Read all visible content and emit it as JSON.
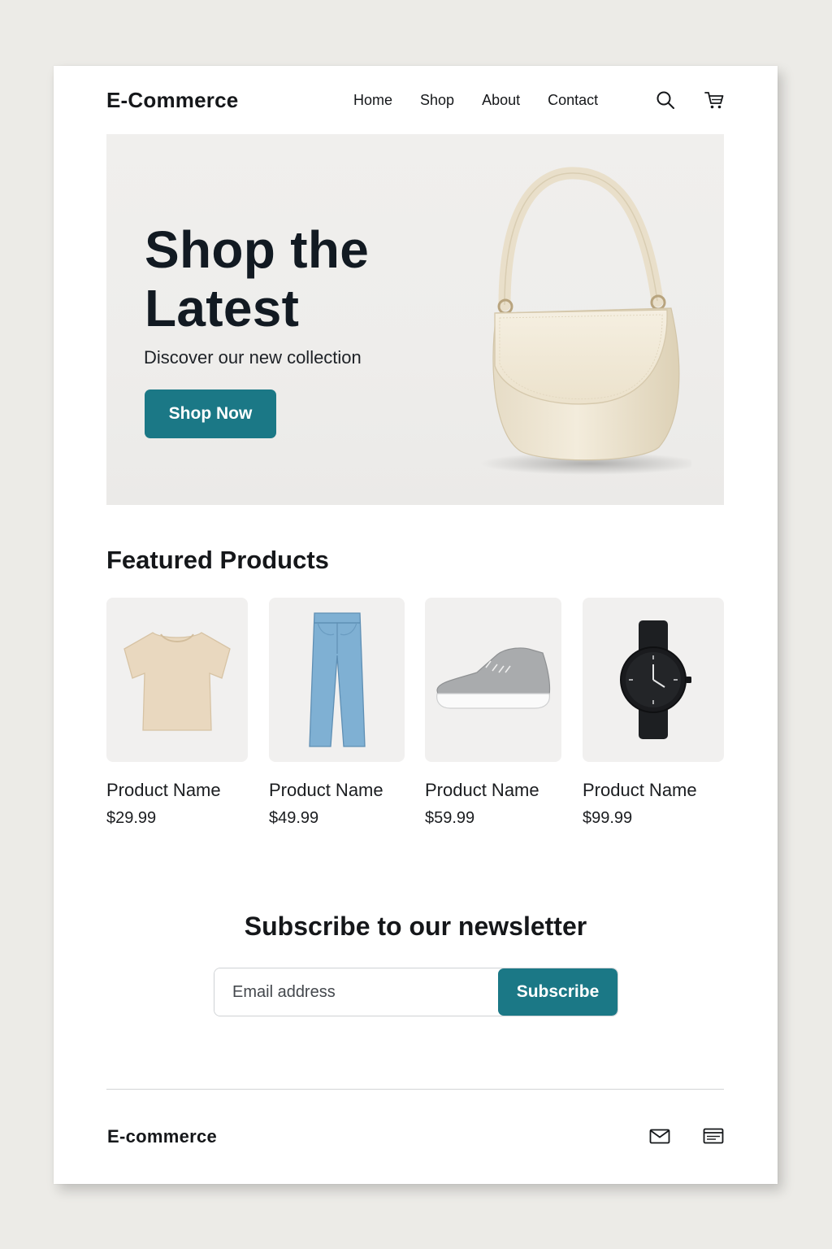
{
  "header": {
    "logo": "E-Commerce",
    "nav": [
      "Home",
      "Shop",
      "About",
      "Contact"
    ],
    "icons": [
      "search-icon",
      "cart-icon"
    ]
  },
  "hero": {
    "title": "Shop the Latest",
    "subtitle": "Discover our new collection",
    "cta_label": "Shop Now",
    "image": "cream-handbag"
  },
  "featured": {
    "title": "Featured Products",
    "products": [
      {
        "name": "Product Name",
        "price": "$29.99",
        "image": "beige-t-shirt"
      },
      {
        "name": "Product Name",
        "price": "$49.99",
        "image": "blue-jeans"
      },
      {
        "name": "Product Name",
        "price": "$59.99",
        "image": "grey-sneaker"
      },
      {
        "name": "Product Name",
        "price": "$99.99",
        "image": "black-watch"
      }
    ]
  },
  "newsletter": {
    "title": "Subscribe to our newsletter",
    "email_placeholder": "Email address",
    "subscribe_label": "Subscribe"
  },
  "footer": {
    "logo": "E-commerce",
    "icons": [
      "mail-icon",
      "card-icon"
    ]
  },
  "colors": {
    "accent": "#1b7886",
    "page_background": "#ecebe7",
    "card_background": "#ffffff",
    "hero_background": "#efeeec"
  }
}
